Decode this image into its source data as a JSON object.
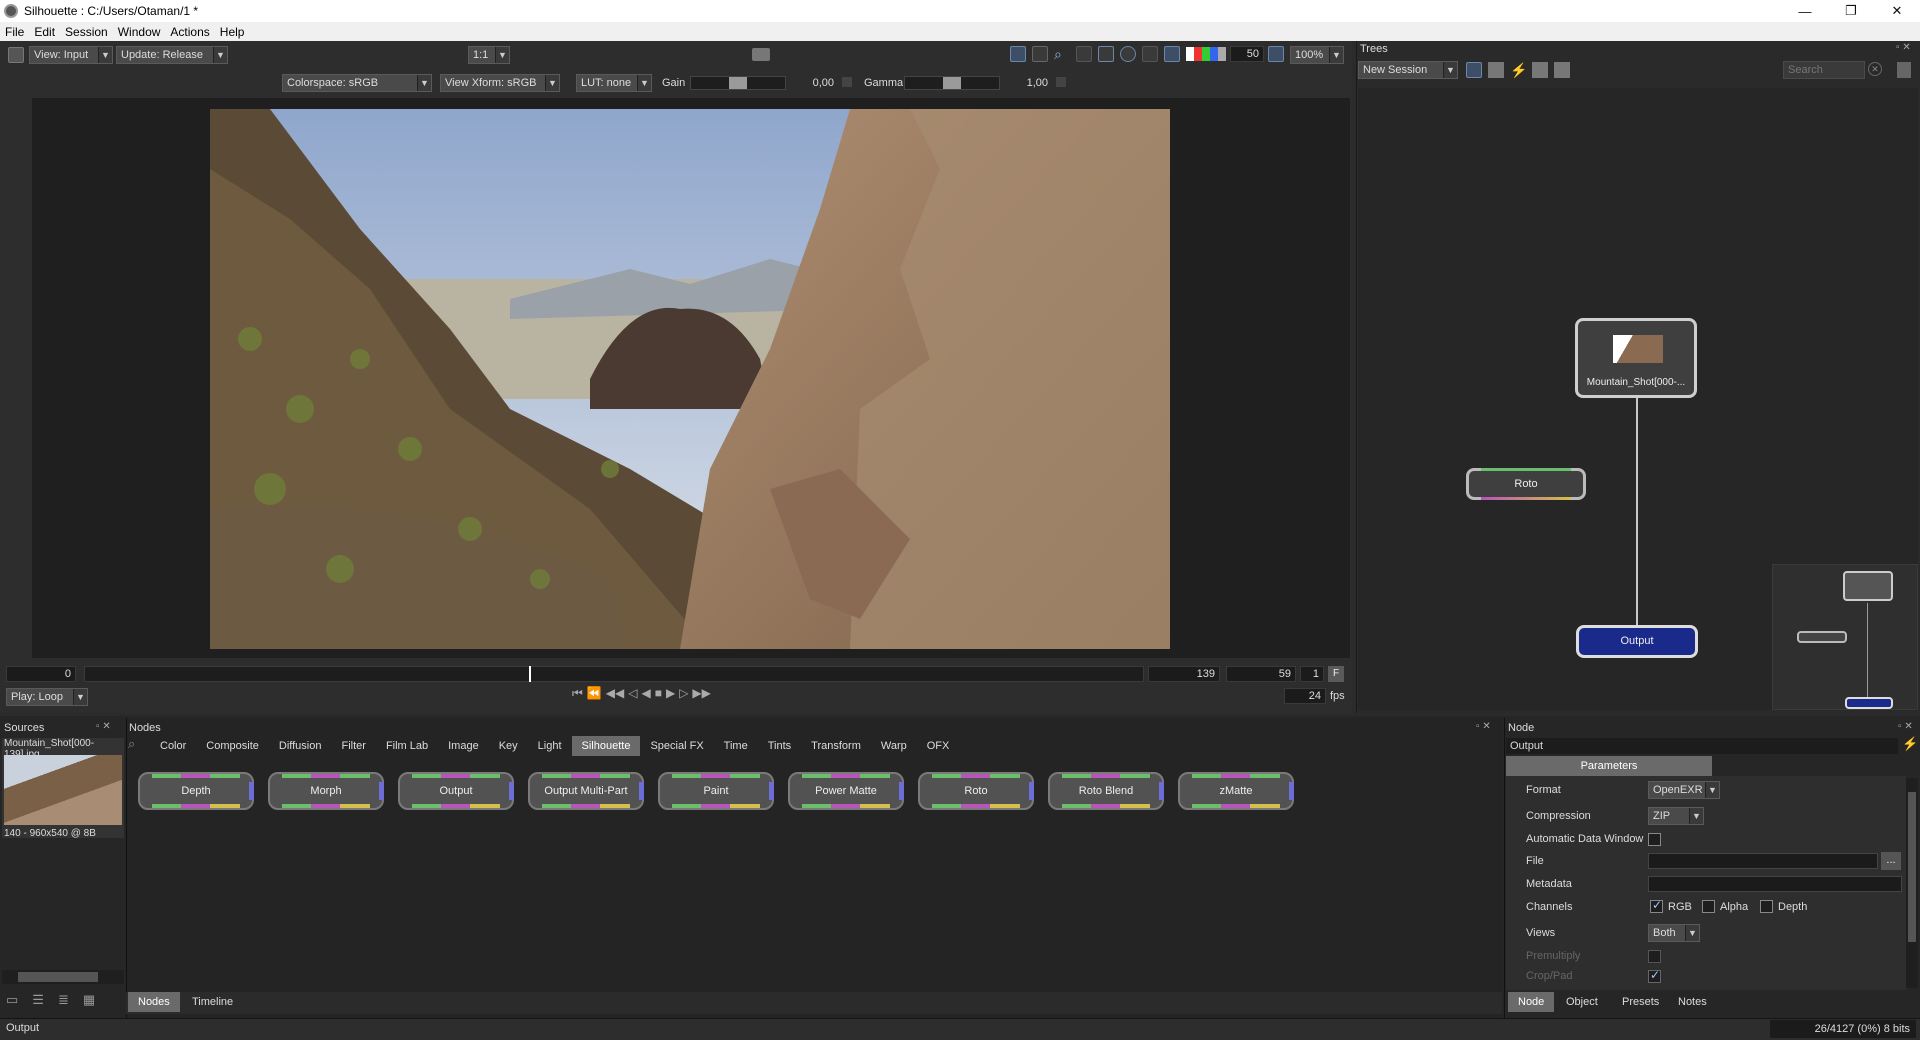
{
  "window": {
    "title": "Silhouette : C:/Users/Otaman/1 *"
  },
  "menu": {
    "file": "File",
    "edit": "Edit",
    "session": "Session",
    "window": "Window",
    "actions": "Actions",
    "help": "Help"
  },
  "viewer_toolbar": {
    "view": "View: Input",
    "update": "Update: Release",
    "scale": "1:1",
    "colorspace": "Colorspace: sRGB",
    "view_xform": "View Xform: sRGB",
    "lut": "LUT: none",
    "gain_label": "Gain",
    "gain_value": "0,00",
    "gamma_label": "Gamma",
    "gamma_value": "1,00",
    "channel_value": "50",
    "zoom": "100%"
  },
  "timeline": {
    "start": "0",
    "end": "139",
    "current": "59",
    "step": "1",
    "f_label": "F",
    "play_mode": "Play: Loop",
    "fps": "24",
    "fps_unit": "fps",
    "playhead_fraction": 0.42
  },
  "trees": {
    "title": "Trees",
    "session": "New Session",
    "search_placeholder": "Search",
    "nodes": {
      "mountain": "Mountain_Shot[000-...",
      "roto": "Roto",
      "output": "Output"
    }
  },
  "sources": {
    "title": "Sources",
    "file": "Mountain_Shot[000-139].jpg",
    "info": "140 - 960x540 @ 8B"
  },
  "nodes_panel": {
    "title": "Nodes",
    "categories": [
      "Color",
      "Composite",
      "Diffusion",
      "Filter",
      "Film Lab",
      "Image",
      "Key",
      "Light",
      "Silhouette",
      "Special FX",
      "Time",
      "Tints",
      "Transform",
      "Warp",
      "OFX"
    ],
    "active_category": "Silhouette",
    "palette": [
      "Depth",
      "Morph",
      "Output",
      "Output Multi-Part",
      "Paint",
      "Power Matte",
      "Roto",
      "Roto Blend",
      "zMatte"
    ],
    "tabs": [
      "Nodes",
      "Timeline"
    ]
  },
  "node_panel": {
    "title": "Node",
    "node_name": "Output",
    "section": "Parameters",
    "format_label": "Format",
    "format_value": "OpenEXR",
    "compression_label": "Compression",
    "compression_value": "ZIP",
    "adw_label": "Automatic Data Window",
    "file_label": "File",
    "file_browse": "...",
    "metadata_label": "Metadata",
    "channels_label": "Channels",
    "ch_rgb": "RGB",
    "ch_alpha": "Alpha",
    "ch_depth": "Depth",
    "views_label": "Views",
    "views_value": "Both",
    "premultiply_label": "Premultiply",
    "croppad_label": "Crop/Pad",
    "tabs": [
      "Node",
      "Object",
      "Presets",
      "Notes"
    ]
  },
  "status": {
    "left": "Output",
    "right": "26/4127 (0%) 8 bits"
  }
}
